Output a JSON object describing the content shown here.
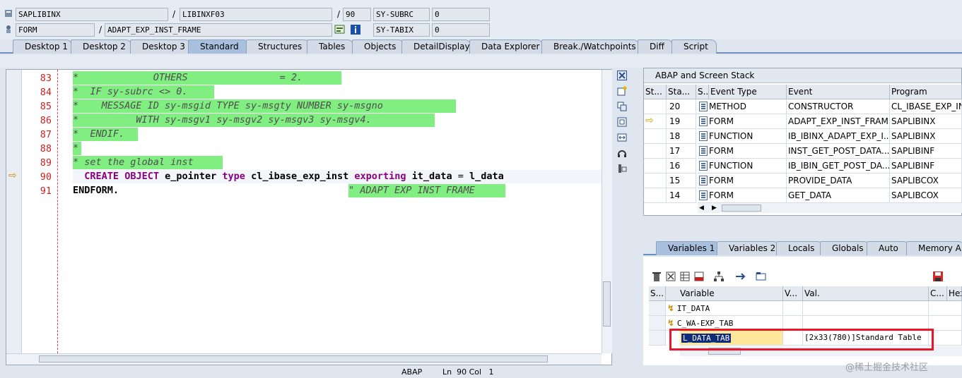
{
  "header": {
    "program": "SAPLIBINX",
    "include": "LIBINXF03",
    "line": "90",
    "sy_subrc_label": "SY-SUBRC",
    "sy_subrc_value": "0",
    "event_type": "FORM",
    "event_name": "ADAPT_EXP_INST_FRAME",
    "sy_tabix_label": "SY-TABIX",
    "sy_tabix_value": "0",
    "slash": "/"
  },
  "tabs": [
    "Desktop 1",
    "Desktop 2",
    "Desktop 3",
    "Standard",
    "Structures",
    "Tables",
    "Objects",
    "DetailDisplay",
    "Data Explorer",
    "Break./Watchpoints",
    "Diff",
    "Script"
  ],
  "active_tab": "Standard",
  "editor": {
    "line_numbers": [
      "83",
      "84",
      "85",
      "86",
      "87",
      "88",
      "89",
      "90",
      "91"
    ],
    "lines": {
      "l83": "*             OTHERS                = 2.",
      "l84": "*  IF sy-subrc <> 0.",
      "l85": "*    MESSAGE ID sy-msgid TYPE sy-msgty NUMBER sy-msgno",
      "l86": "*          WITH sy-msgv1 sy-msgv2 sy-msgv3 sy-msgv4.",
      "l87": "*  ENDIF.",
      "l88": "*",
      "l89": "* set the global inst",
      "l90_create": "CREATE",
      "l90_object": "OBJECT",
      "l90_target": "e_pointer",
      "l90_type": "type",
      "l90_class": "cl_ibase_exp_inst",
      "l90_exporting": "exporting",
      "l90_param": "it_data",
      "l90_eq": "=",
      "l90_value": "l_data",
      "l91": "ENDFORM.",
      "l91_comment": "\" ADAPT EXP INST FRAME"
    },
    "current_line_marker": "⇨"
  },
  "status": {
    "language": "ABAP",
    "position": "Ln  90 Col   1"
  },
  "stack": {
    "title": "ABAP and Screen Stack",
    "columns": [
      "St...",
      "Sta...",
      "S...",
      "Event Type",
      "Event",
      "Program"
    ],
    "rows": [
      {
        "level": "20",
        "event_type": "METHOD",
        "event": "CONSTRUCTOR",
        "program": "CL_IBASE_EXP_INST"
      },
      {
        "level": "19",
        "event_type": "FORM",
        "event": "ADAPT_EXP_INST_FRAM...",
        "program": "SAPLIBINX",
        "current": true
      },
      {
        "level": "18",
        "event_type": "FUNCTION",
        "event": "IB_IBINX_ADAPT_EXP_I...",
        "program": "SAPLIBINX"
      },
      {
        "level": "17",
        "event_type": "FORM",
        "event": "INST_GET_POST_DATA...",
        "program": "SAPLIBINF"
      },
      {
        "level": "16",
        "event_type": "FUNCTION",
        "event": "IB_IBIN_GET_POST_DA...",
        "program": "SAPLIBINF"
      },
      {
        "level": "15",
        "event_type": "FORM",
        "event": "PROVIDE_DATA",
        "program": "SAPLIBCOX"
      },
      {
        "level": "14",
        "event_type": "FORM",
        "event": "GET_DATA",
        "program": "SAPLIBCOX"
      }
    ]
  },
  "variables": {
    "tabs": [
      "Variables 1",
      "Variables 2",
      "Locals",
      "Globals",
      "Auto",
      "Memory Ana"
    ],
    "columns": [
      "S...",
      "Variable",
      "V...",
      "Val.",
      "C...",
      "Hex"
    ],
    "rows": [
      {
        "name": "IT_DATA",
        "value": ""
      },
      {
        "name": "C_WA-EXP_TAB",
        "value": ""
      },
      {
        "name": "L_DATA_TAB",
        "value": "[2x33(780)]Standard Table"
      }
    ]
  },
  "watermark": "@稀土掘金技术社区",
  "colors": {
    "comment_bg": "#80ee80",
    "keyword": "#8a0080",
    "line_number": "#d02020",
    "highlight_box": "#e8182a",
    "selected_var_bg": "#0f2b7a",
    "active_tab_bg": "#a8c0de"
  }
}
